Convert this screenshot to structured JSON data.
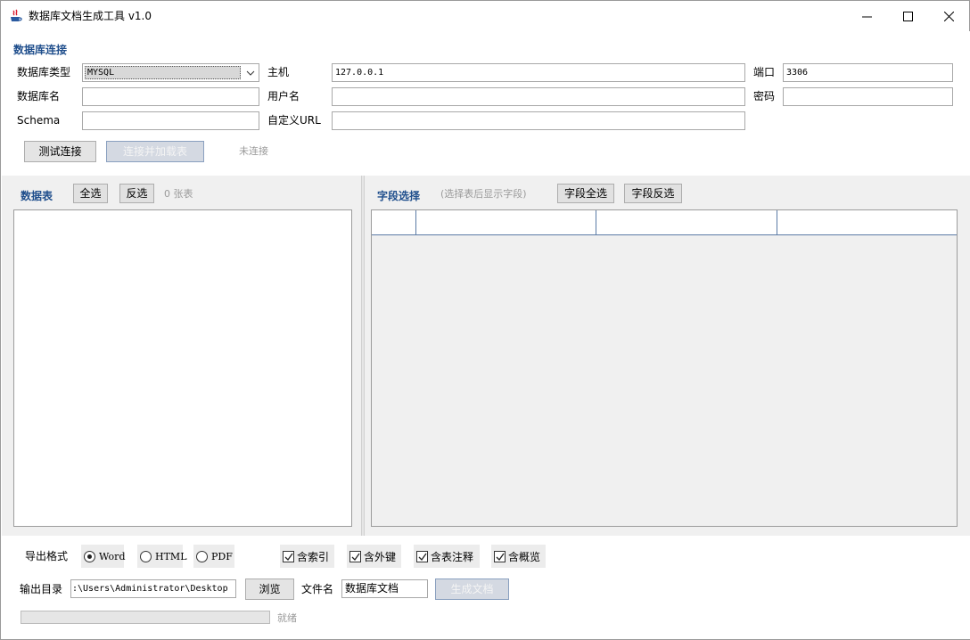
{
  "window": {
    "title": "数据库文档生成工具 v1.0"
  },
  "connection": {
    "section_title": "数据库连接",
    "db_type_label": "数据库类型",
    "db_type_value": "MYSQL",
    "host_label": "主机",
    "host_value": "127.0.0.1",
    "port_label": "端口",
    "port_value": "3306",
    "db_name_label": "数据库名",
    "db_name_value": "",
    "username_label": "用户名",
    "username_value": "",
    "password_label": "密码",
    "password_value": "",
    "schema_label": "Schema",
    "schema_value": "",
    "custom_url_label": "自定义URL",
    "custom_url_value": "",
    "test_button": "测试连接",
    "connect_button": "连接并加载表",
    "status": "未连接"
  },
  "tables_panel": {
    "title": "数据表",
    "select_all": "全选",
    "invert": "反选",
    "count": "0 张表"
  },
  "fields_panel": {
    "title": "字段选择",
    "hint": "(选择表后显示字段)",
    "select_all": "字段全选",
    "invert": "字段反选"
  },
  "export": {
    "format_label": "导出格式",
    "formats": [
      {
        "label": "Word",
        "selected": true
      },
      {
        "label": "HTML",
        "selected": false
      },
      {
        "label": "PDF",
        "selected": false
      }
    ],
    "options": [
      {
        "label": "含索引",
        "checked": true
      },
      {
        "label": "含外键",
        "checked": true
      },
      {
        "label": "含表注释",
        "checked": true
      },
      {
        "label": "含概览",
        "checked": true
      }
    ],
    "output_dir_label": "输出目录",
    "output_dir_value": ":\\Users\\Administrator\\Desktop",
    "browse_button": "浏览",
    "filename_label": "文件名",
    "filename_value": "数据库文档",
    "generate_button": "生成文档",
    "progress": 0,
    "status": "就绪"
  },
  "colors": {
    "accent": "#1f4e8c",
    "muted": "#9a9a9a",
    "panel_bg": "#f0f0f0"
  }
}
